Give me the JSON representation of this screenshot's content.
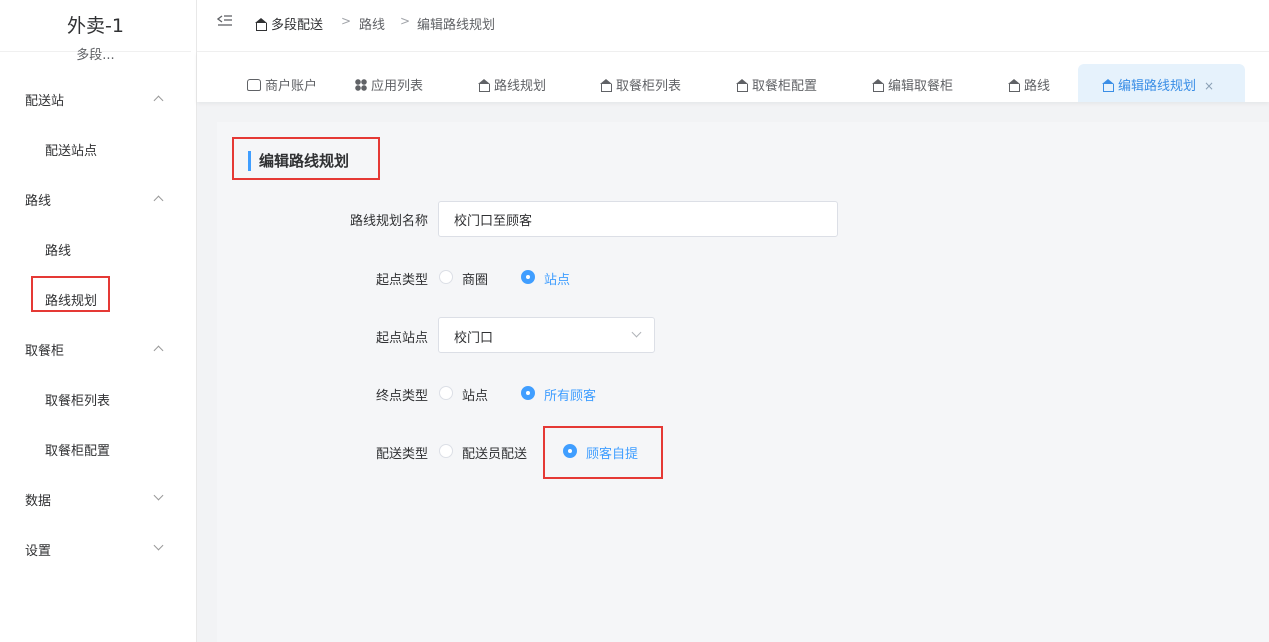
{
  "sidebar": {
    "brand_title": "外卖-1",
    "brand_sub": "多段...",
    "groups": [
      {
        "label": "配送站",
        "items": [
          {
            "label": "配送站点"
          }
        ]
      },
      {
        "label": "路线",
        "items": [
          {
            "label": "路线"
          },
          {
            "label": "路线规划"
          }
        ]
      },
      {
        "label": "取餐柜",
        "items": [
          {
            "label": "取餐柜列表"
          },
          {
            "label": "取餐柜配置"
          }
        ]
      },
      {
        "label": "数据",
        "items": []
      },
      {
        "label": "设置",
        "items": []
      }
    ]
  },
  "breadcrumb": [
    "多段配送",
    "路线",
    "编辑路线规划"
  ],
  "breadcrumb_separator": ">",
  "tabs": [
    {
      "label": "商户账户",
      "icon": "store-icon"
    },
    {
      "label": "应用列表",
      "icon": "grid-icon"
    },
    {
      "label": "路线规划",
      "icon": "home-icon"
    },
    {
      "label": "取餐柜列表",
      "icon": "home-icon"
    },
    {
      "label": "取餐柜配置",
      "icon": "home-icon"
    },
    {
      "label": "编辑取餐柜",
      "icon": "home-icon"
    },
    {
      "label": "路线",
      "icon": "home-icon"
    },
    {
      "label": "编辑路线规划",
      "icon": "home-icon",
      "active": true,
      "close": "×"
    }
  ],
  "page_title": "编辑路线规划",
  "form": {
    "route_name": {
      "label": "路线规划名称",
      "value": "校门口至顾客"
    },
    "start_type": {
      "label": "起点类型",
      "options": [
        "商圈",
        "站点"
      ],
      "selected": "站点"
    },
    "start_station": {
      "label": "起点站点",
      "value": "校门口"
    },
    "end_type": {
      "label": "终点类型",
      "options": [
        "站点",
        "所有顾客"
      ],
      "selected": "所有顾客"
    },
    "delivery_type": {
      "label": "配送类型",
      "options": [
        "配送员配送",
        "顾客自提"
      ],
      "selected": "顾客自提"
    }
  },
  "colors": {
    "accent": "#409eff",
    "highlight_box": "#e53935",
    "active_tab_bg": "#e6f2fc"
  }
}
